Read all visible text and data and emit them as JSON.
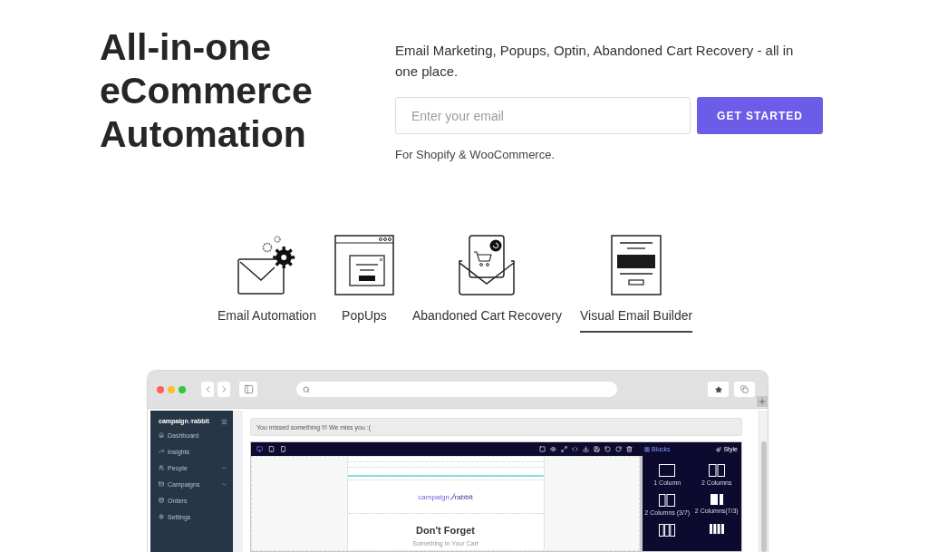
{
  "hero": {
    "title": "All-in-one eCommerce Automation",
    "tagline": "Email Marketing, Popups, Optin, Abandoned Cart Recovery - all in one place.",
    "email_field": {
      "placeholder": "Enter your email"
    },
    "cta_button": "GET STARTED",
    "platform_note": "For Shopify & WooCommerce."
  },
  "feature_tabs": [
    {
      "kind": "automation",
      "label": "Email Automation",
      "selected": false
    },
    {
      "kind": "popup",
      "label": "PopUps",
      "selected": false
    },
    {
      "kind": "cart",
      "label": "Abandoned Cart Recovery",
      "selected": false
    },
    {
      "kind": "builder",
      "label": "Visual Email Builder",
      "selected": true
    }
  ],
  "browser_mockup": {
    "window_controls": [
      {
        "color": "#fe5f57"
      },
      {
        "color": "#febc2e"
      },
      {
        "color": "#28c840"
      }
    ],
    "sidebar": {
      "logo": [
        "campaign",
        "rabbit"
      ],
      "items": [
        {
          "label": "Dashboard",
          "submenu": false
        },
        {
          "label": "Insights",
          "submenu": false
        },
        {
          "label": "People",
          "submenu": true
        },
        {
          "label": "Campaigns",
          "submenu": true
        },
        {
          "label": "Orders",
          "submenu": false
        },
        {
          "label": "Settings",
          "submenu": false
        }
      ]
    },
    "alert": "You missed something !!! We miss you :(",
    "editor": {
      "devices": [
        {
          "selected": true
        },
        {
          "selected": false
        },
        {
          "selected": false
        }
      ],
      "panel_tabs": [
        {
          "label": "Blocks",
          "selected": true
        },
        {
          "label": "Style",
          "selected": false
        }
      ],
      "email": {
        "logo": [
          "campaign",
          "rabbit"
        ],
        "heading": "Don't Forget",
        "subheading": "Something In Your Cart"
      },
      "blocks": [
        {
          "kind": "single",
          "label": "1 Column"
        },
        {
          "kind": "double",
          "label": "2 Columns"
        },
        {
          "kind": "narrow-left",
          "label": "2 Columns (3/7)"
        },
        {
          "kind": "narrow-right",
          "label": "2 Columns(7/3)"
        },
        {
          "kind": "triple"
        },
        {
          "kind": "quad"
        }
      ]
    }
  }
}
